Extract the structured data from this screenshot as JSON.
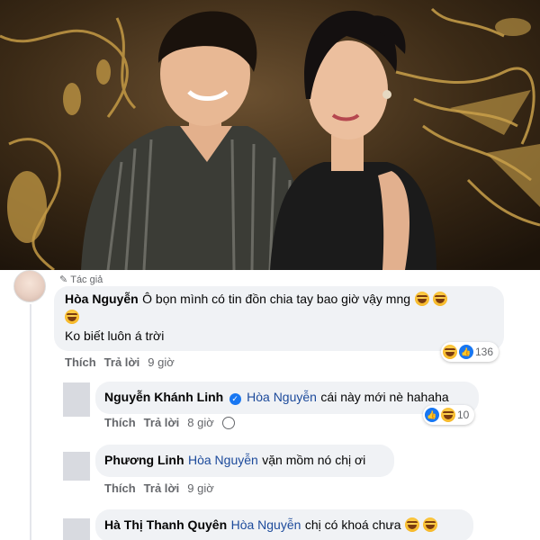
{
  "photo": {
    "palette": {
      "background": "#3a2a17",
      "gold": "#c49a45",
      "shirt": "#3b3c36",
      "dress": "#1b1b1b",
      "skin": "#e8b894"
    }
  },
  "comments": [
    {
      "author_tag": "Tác giả",
      "name": "Hòa Nguyễn",
      "text_line1": "Ô bọn mình có tin đồn chia tay bao giờ vậy mng",
      "text_line2": "Ko biết luôn á trời",
      "actions": {
        "like": "Thích",
        "reply": "Trả lời",
        "time": "9 giờ"
      },
      "reaction_count": "136"
    },
    {
      "name": "Nguyễn Khánh Linh",
      "verified": true,
      "mention": "Hòa Nguyễn",
      "text": "cái này mới nè hahaha",
      "actions": {
        "like": "Thích",
        "reply": "Trả lời",
        "time": "8 giờ"
      },
      "reaction_count": "10"
    },
    {
      "name": "Phương Linh",
      "mention": "Hòa Nguyễn",
      "text": "vặn mồm nó chị ơi",
      "actions": {
        "like": "Thích",
        "reply": "Trả lời",
        "time": "9 giờ"
      }
    },
    {
      "name": "Hà Thị Thanh Quyên",
      "mention": "Hòa Nguyễn",
      "text": "chị có khoá chưa"
    }
  ],
  "colors": {
    "bubble": "#f0f2f5",
    "link": "#1c4a9b",
    "meta": "#65676b",
    "facebook_blue": "#1877f2"
  },
  "icons": [
    "pencil-icon",
    "laugh-emoji-icon",
    "like-reaction-icon",
    "verified-badge-icon"
  ]
}
